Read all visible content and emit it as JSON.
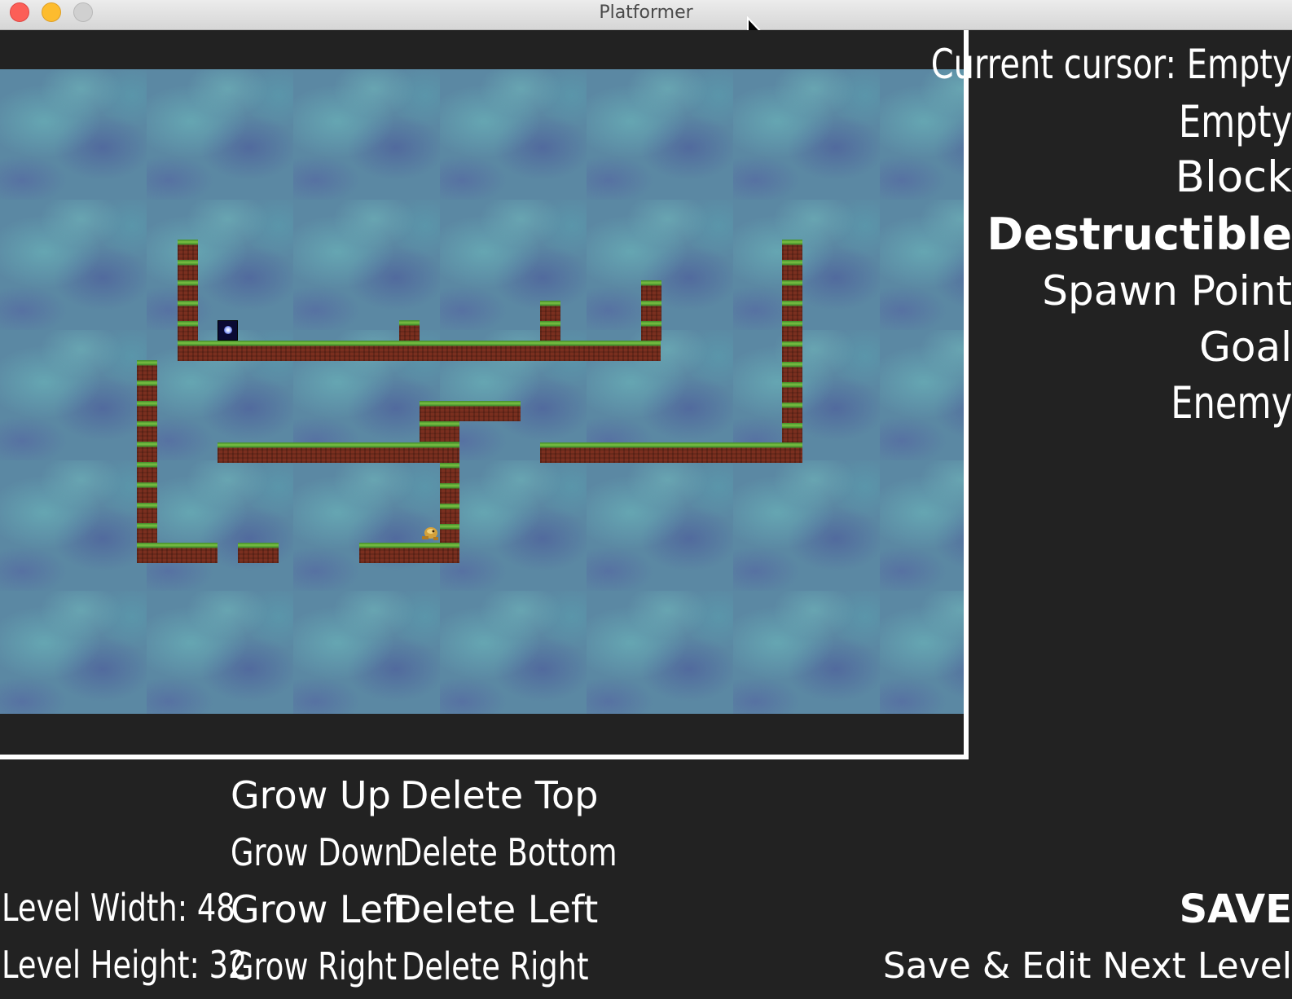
{
  "window": {
    "title": "Platformer"
  },
  "palette": {
    "current_cursor": "Current cursor: Empty",
    "items": [
      "Empty",
      "Block",
      "Destructible",
      "Spawn Point",
      "Goal",
      "Enemy"
    ]
  },
  "controls": {
    "grow_up": "Grow Up",
    "delete_top": "Delete Top",
    "grow_down": "Grow Down",
    "delete_bottom": "Delete Bottom",
    "grow_left": "Grow Left",
    "delete_left": "Delete Left",
    "grow_right": "Grow Right",
    "delete_right": "Delete Right"
  },
  "level": {
    "width_label": "Level Width: 48",
    "height_label": "Level Height: 32"
  },
  "actions": {
    "save": "SAVE",
    "save_next": "Save & Edit Next Level"
  },
  "colors": {
    "background": "#222222",
    "dirt": "#7a2f1f",
    "grass": "#7bc043",
    "sky": "#5b88a3"
  }
}
